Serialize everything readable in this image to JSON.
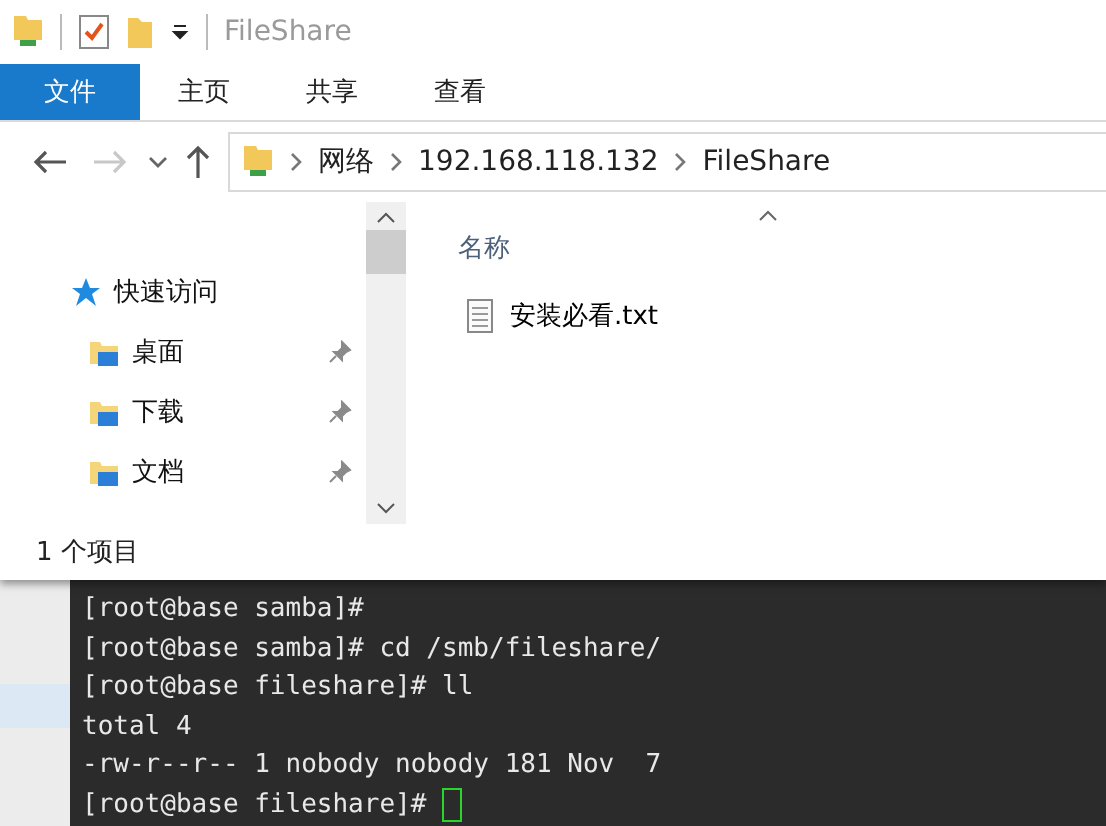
{
  "window": {
    "title": "FileShare"
  },
  "ribbon_tabs": [
    {
      "label": "文件",
      "kind": "file"
    },
    {
      "label": "主页",
      "kind": "tab"
    },
    {
      "label": "共享",
      "kind": "tab"
    },
    {
      "label": "查看",
      "kind": "tab"
    }
  ],
  "navigation": {
    "back_disabled": false,
    "forward_disabled": true
  },
  "address_bar": {
    "segments": [
      "网络",
      "192.168.118.132",
      "FileShare"
    ]
  },
  "sidebar": {
    "items": [
      {
        "label": "快速访问",
        "kind": "header"
      },
      {
        "label": "桌面",
        "kind": "pinned"
      },
      {
        "label": "下载",
        "kind": "pinned"
      },
      {
        "label": "文档",
        "kind": "pinned"
      }
    ]
  },
  "file_list": {
    "columns": [
      "名称"
    ],
    "rows": [
      {
        "name": "安装必看.txt",
        "selected": false
      }
    ]
  },
  "status_bar": {
    "text": "1 个项目"
  },
  "terminal": {
    "lines": [
      "[root@base samba]#",
      "[root@base samba]# cd /smb/fileshare/",
      "[root@base fileshare]# ll",
      "total 4",
      "-rw-r--r-- 1 nobody nobody 181 Nov  7",
      "[root@base fileshare]# "
    ]
  }
}
